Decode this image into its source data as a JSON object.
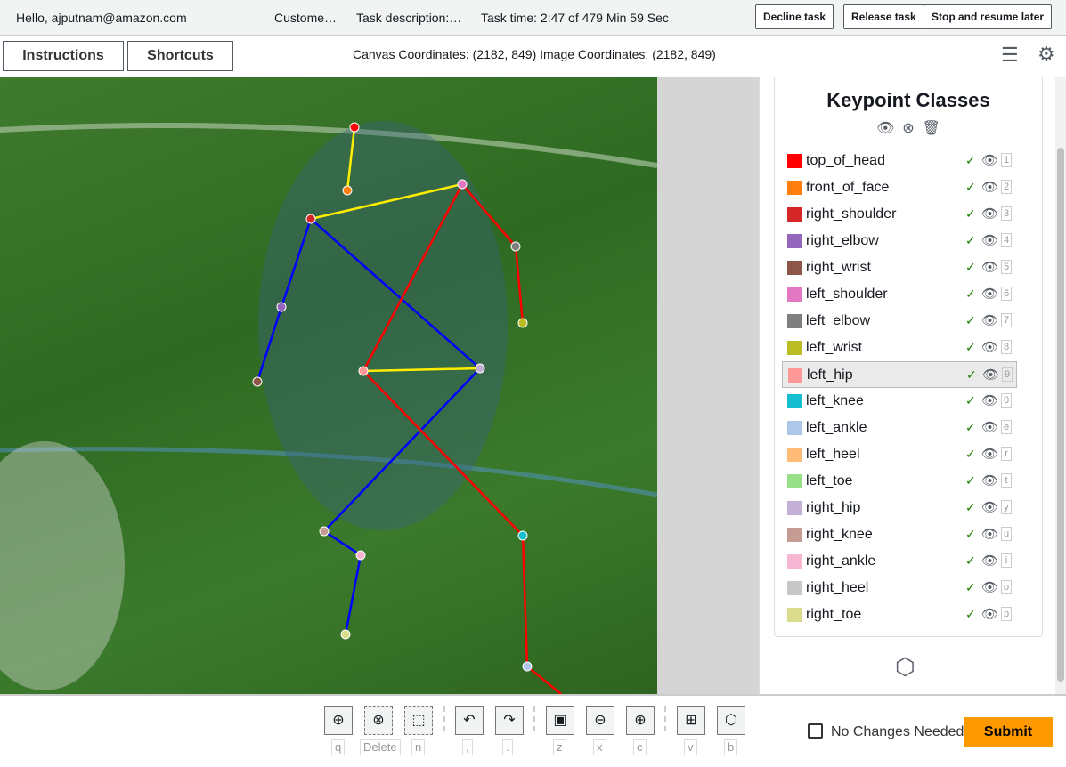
{
  "header": {
    "greeting": "Hello, ajputnam@amazon.com",
    "customer": "Custome…",
    "task_description": "Task description:…",
    "task_time": "Task time: 2:47 of 479 Min 59 Sec",
    "decline": "Decline task",
    "release": "Release task",
    "stop": "Stop and resume later"
  },
  "toolbar": {
    "instructions": "Instructions",
    "shortcuts": "Shortcuts",
    "coordinates": "Canvas Coordinates: (2182, 849) Image Coordinates: (2182, 849)"
  },
  "panel": {
    "title": "Keypoint Classes",
    "selected": "left_hip",
    "classes": [
      {
        "label": "top_of_head",
        "color": "#ff0000",
        "key": "1"
      },
      {
        "label": "front_of_face",
        "color": "#ff7f0e",
        "key": "2"
      },
      {
        "label": "right_shoulder",
        "color": "#d62728",
        "key": "3"
      },
      {
        "label": "right_elbow",
        "color": "#9467bd",
        "key": "4"
      },
      {
        "label": "right_wrist",
        "color": "#8c564b",
        "key": "5"
      },
      {
        "label": "left_shoulder",
        "color": "#e377c2",
        "key": "6"
      },
      {
        "label": "left_elbow",
        "color": "#7f7f7f",
        "key": "7"
      },
      {
        "label": "left_wrist",
        "color": "#bcbd22",
        "key": "8"
      },
      {
        "label": "left_hip",
        "color": "#ff9896",
        "key": "9"
      },
      {
        "label": "left_knee",
        "color": "#17becf",
        "key": "0"
      },
      {
        "label": "left_ankle",
        "color": "#aec7e8",
        "key": "e"
      },
      {
        "label": "left_heel",
        "color": "#ffbb78",
        "key": "r"
      },
      {
        "label": "left_toe",
        "color": "#98df8a",
        "key": "t"
      },
      {
        "label": "right_hip",
        "color": "#c5b0d5",
        "key": "y"
      },
      {
        "label": "right_knee",
        "color": "#c49c94",
        "key": "u"
      },
      {
        "label": "right_ankle",
        "color": "#f7b6d2",
        "key": "i"
      },
      {
        "label": "right_heel",
        "color": "#c7c7c7",
        "key": "o"
      },
      {
        "label": "right_toe",
        "color": "#dbdb8d",
        "key": "p"
      }
    ]
  },
  "tools": [
    {
      "name": "add-point",
      "glyph": "⊕",
      "key": "q"
    },
    {
      "name": "delete",
      "glyph": "⊗",
      "key": "Delete"
    },
    {
      "name": "select",
      "glyph": "⬚",
      "key": "n"
    },
    {
      "name": "undo",
      "glyph": "↶",
      "key": ","
    },
    {
      "name": "redo",
      "glyph": "↷",
      "key": "."
    },
    {
      "name": "fit",
      "glyph": "▣",
      "key": "z"
    },
    {
      "name": "zoom-out",
      "glyph": "⊖",
      "key": "x"
    },
    {
      "name": "zoom-in",
      "glyph": "⊕",
      "key": "c"
    },
    {
      "name": "add-box",
      "glyph": "⊞",
      "key": "v"
    },
    {
      "name": "add-polygon",
      "glyph": "⬡",
      "key": "b"
    }
  ],
  "footer": {
    "no_changes": "No Changes Needed",
    "submit": "Submit"
  },
  "accent": "#ff9900"
}
